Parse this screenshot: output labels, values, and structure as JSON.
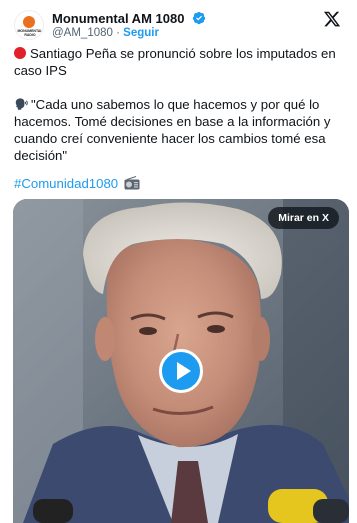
{
  "account": {
    "avatar_text": "MONUMENTAL RADIO",
    "name": "Monumental AM 1080",
    "handle": "@AM_1080",
    "separator": "·",
    "follow_label": "Seguir"
  },
  "tweet": {
    "line1": "Santiago Peña se pronunció sobre los imputados en caso IPS",
    "quote": "\"Cada uno sabemos lo que hacemos y por qué lo hacemos. Tomé decisiones en base a la información y cuando creí conveniente hacer los cambios tomé esa decisión\"",
    "hashtag": "#Comunidad1080"
  },
  "media": {
    "watch_label": "Mirar en X",
    "play_icon": "play-icon"
  },
  "colors": {
    "accent": "#1d9bf0",
    "alert_dot": "#e0202a",
    "text": "#0f1419",
    "muted": "#536471"
  }
}
